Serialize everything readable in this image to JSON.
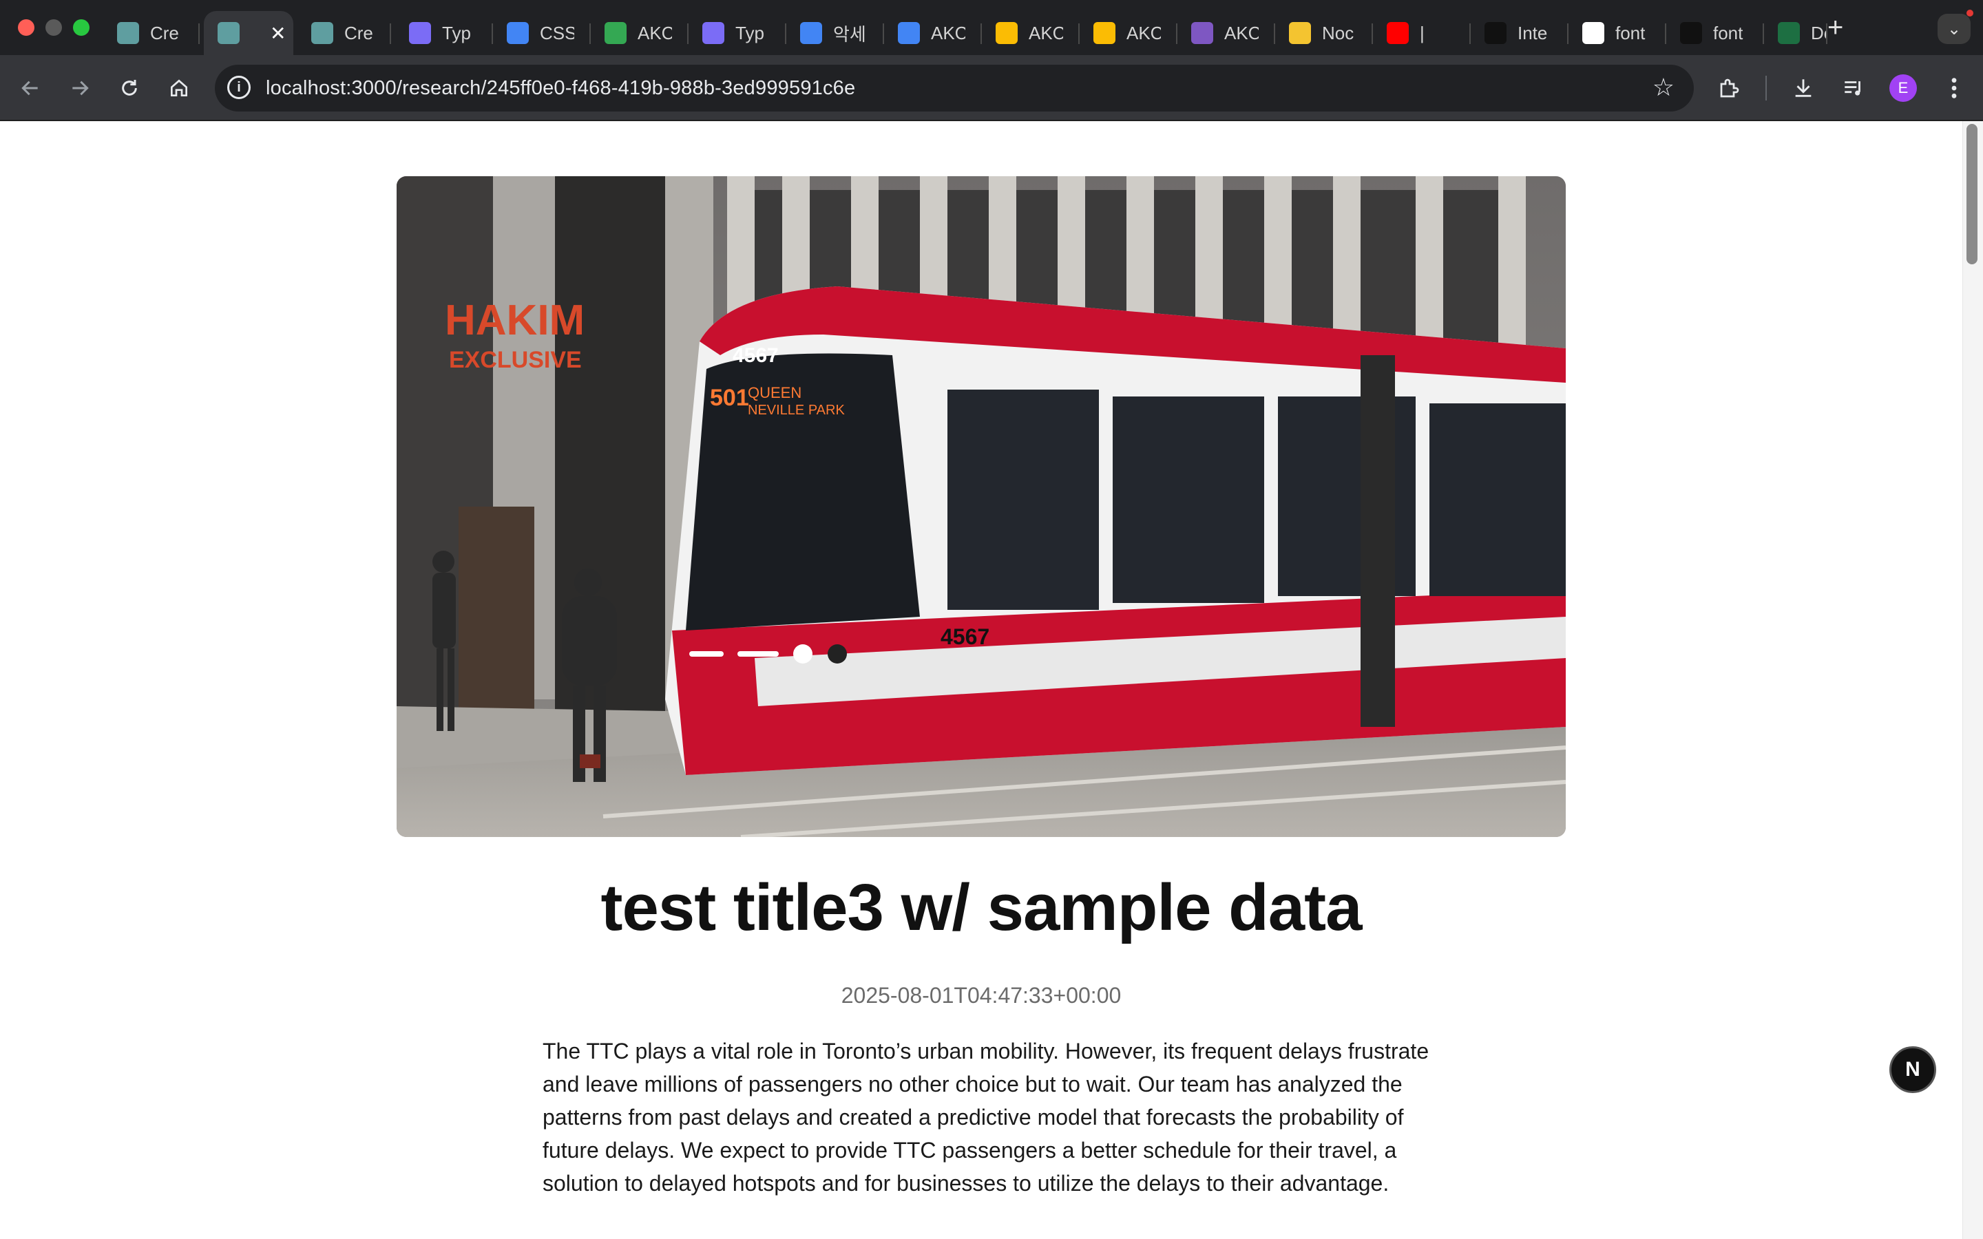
{
  "browser": {
    "tabs": [
      {
        "label": "Cre",
        "icon": "stacked-logo-icon",
        "color": "#5f9ea0"
      },
      {
        "label": "",
        "icon": "stacked-logo-icon",
        "color": "#5f9ea0",
        "active": true
      },
      {
        "label": "Cre",
        "icon": "stacked-logo-icon",
        "color": "#5f9ea0"
      },
      {
        "label": "Typ",
        "icon": "typeform-icon",
        "color": "#7b6cf6"
      },
      {
        "label": "CSS",
        "icon": "docs-icon",
        "color": "#4285f4"
      },
      {
        "label": "AKC",
        "icon": "bolt-icon",
        "color": "#34a853"
      },
      {
        "label": "Typ",
        "icon": "typeform-icon",
        "color": "#7b6cf6"
      },
      {
        "label": "악세",
        "icon": "docs-icon",
        "color": "#4285f4"
      },
      {
        "label": "AKC",
        "icon": "docs-icon",
        "color": "#4285f4"
      },
      {
        "label": "AKC",
        "icon": "drive-icon",
        "color": "#fbbc04"
      },
      {
        "label": "AKC",
        "icon": "drive-icon",
        "color": "#fbbc04"
      },
      {
        "label": "AKC",
        "icon": "calendar-icon",
        "color": "#7e57c2"
      },
      {
        "label": "Noc",
        "icon": "duck-icon",
        "color": "#f4c430"
      },
      {
        "label": "|",
        "icon": "youtube-icon",
        "color": "#ff0000"
      },
      {
        "label": "Inte",
        "icon": "aa-icon",
        "color": "#111111"
      },
      {
        "label": "font",
        "icon": "google-icon",
        "color": "#ffffff"
      },
      {
        "label": "font",
        "icon": "medium-icon",
        "color": "#111111"
      },
      {
        "label": "Dow",
        "icon": "excel-icon",
        "color": "#1d6f42"
      }
    ],
    "tab_close_glyph": "✕",
    "new_tab_glyph": "+",
    "address": "localhost:3000/research/245ff0e0-f468-419b-988b-3ed999591c6e",
    "avatar_letter": "E"
  },
  "article": {
    "title": "test title3 w/ sample data",
    "timestamp": "2025-08-01T04:47:33+00:00",
    "body": "The TTC plays a vital role in Toronto’s urban mobility. However, its frequent delays frustrate and leave millions of passengers no other choice but to wait. Our team has analyzed the patterns from past delays and created a predictive model that forecasts the probability of future delays. We expect to provide TTC passengers a better schedule for their travel, a solution to delayed hotspots and for businesses to utilize the delays to their advantage.",
    "hero_image": {
      "subject": "streetcar",
      "streetcar_number": "4567",
      "destination_route": "501",
      "destination_text": "QUEEN NEVILLE PARK",
      "storefront_sign": [
        "HAKIM",
        "EXCLUSIVE"
      ],
      "colors": {
        "streetcar_red": "#c8102e",
        "streetcar_white": "#f2f2f2"
      }
    }
  },
  "dev_badge": "N"
}
